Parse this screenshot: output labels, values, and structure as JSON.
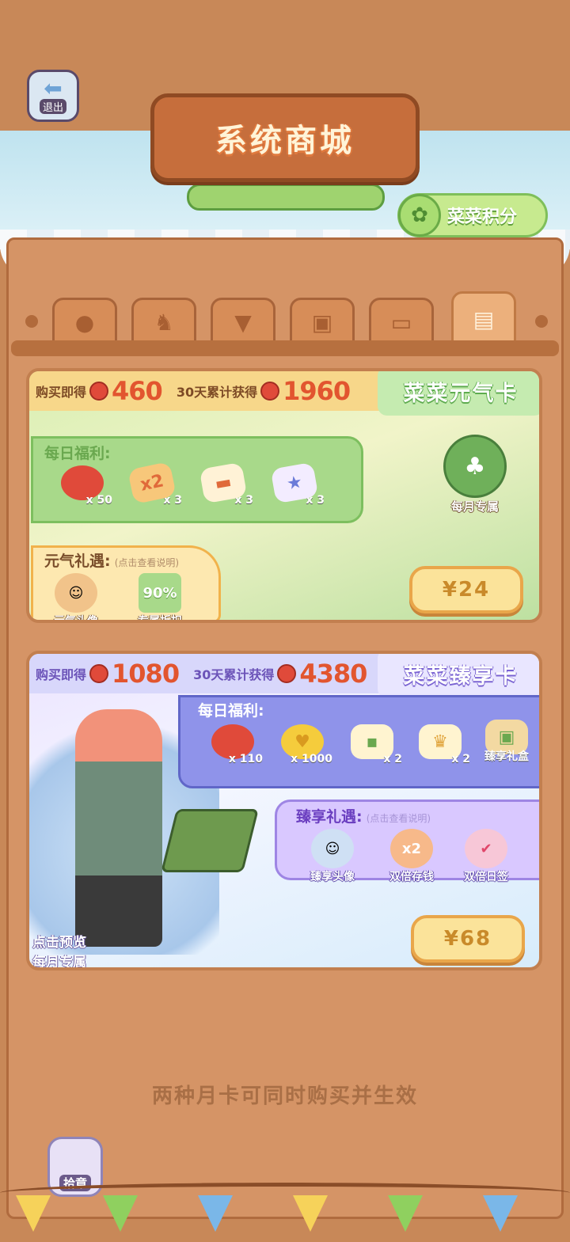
{
  "header": {
    "title": "系统商城",
    "exit_label": "退出",
    "points_label": "菜菜积分"
  },
  "tabs": [
    {
      "name": "fruit",
      "icon": "orange-fruit-icon"
    },
    {
      "name": "animal",
      "icon": "llama-icon"
    },
    {
      "name": "clothing",
      "icon": "shirt-icon"
    },
    {
      "name": "gift",
      "icon": "gift-box-icon"
    },
    {
      "name": "coupon",
      "icon": "ticket-icon"
    },
    {
      "name": "card",
      "icon": "card-icon",
      "active": true
    }
  ],
  "card1": {
    "title": "菜菜元气卡",
    "buy_label": "购买即得",
    "buy_value": "460",
    "accum_label": "30天累计获得",
    "accum_value": "1960",
    "daily_label": "每日福利:",
    "daily_items": [
      {
        "icon": "cherry-icon",
        "qty": "x 50"
      },
      {
        "icon": "double-ticket-icon",
        "qty": "x 3",
        "pic_text": "x2"
      },
      {
        "icon": "truck-ticket-icon",
        "qty": "x 3"
      },
      {
        "icon": "star-ticket-icon",
        "qty": "x 3"
      }
    ],
    "monthly_label": "每月专属",
    "perk_label": "元气礼遇:",
    "perk_note": "(点击查看说明)",
    "perks": [
      {
        "icon": "avatar-icon",
        "label": "元气头像"
      },
      {
        "icon": "discount-icon",
        "label": "专属折扣",
        "pic_text": "90%"
      }
    ],
    "price": "¥24"
  },
  "card2": {
    "title": "菜菜臻享卡",
    "buy_label": "购买即得",
    "buy_value": "1080",
    "accum_label": "30天累计获得",
    "accum_value": "4380",
    "daily_label": "每日福利:",
    "daily_items": [
      {
        "icon": "cherry-icon",
        "qty": "x 110"
      },
      {
        "icon": "gold-coin-icon",
        "qty": "x 1000"
      },
      {
        "icon": "tofu-sprout-icon",
        "qty": "x 2"
      },
      {
        "icon": "crowned-tofu-icon",
        "qty": "x 2"
      },
      {
        "icon": "gift-box-icon",
        "qty": "臻享礼盒"
      }
    ],
    "perk_label": "臻享礼遇:",
    "perk_note": "(点击查看说明)",
    "perks": [
      {
        "icon": "avatar-icon",
        "label": "臻享头像"
      },
      {
        "icon": "double-coin-icon",
        "label": "双倍存钱",
        "pic_text": "x2"
      },
      {
        "icon": "check-calendar-icon",
        "label": "双倍日签"
      }
    ],
    "preview_line1": "点击预览",
    "preview_line2": "每月专属",
    "price": "¥68"
  },
  "footer": {
    "note": "两种月卡可同时购买并生效",
    "badge_label": "拾章"
  },
  "colors": {
    "wall": "#c88858",
    "accent_orange": "#e2552f",
    "card1_green": "#a8d98a",
    "card2_purple": "#8f93ea",
    "price_yellow": "#fbe39a"
  }
}
